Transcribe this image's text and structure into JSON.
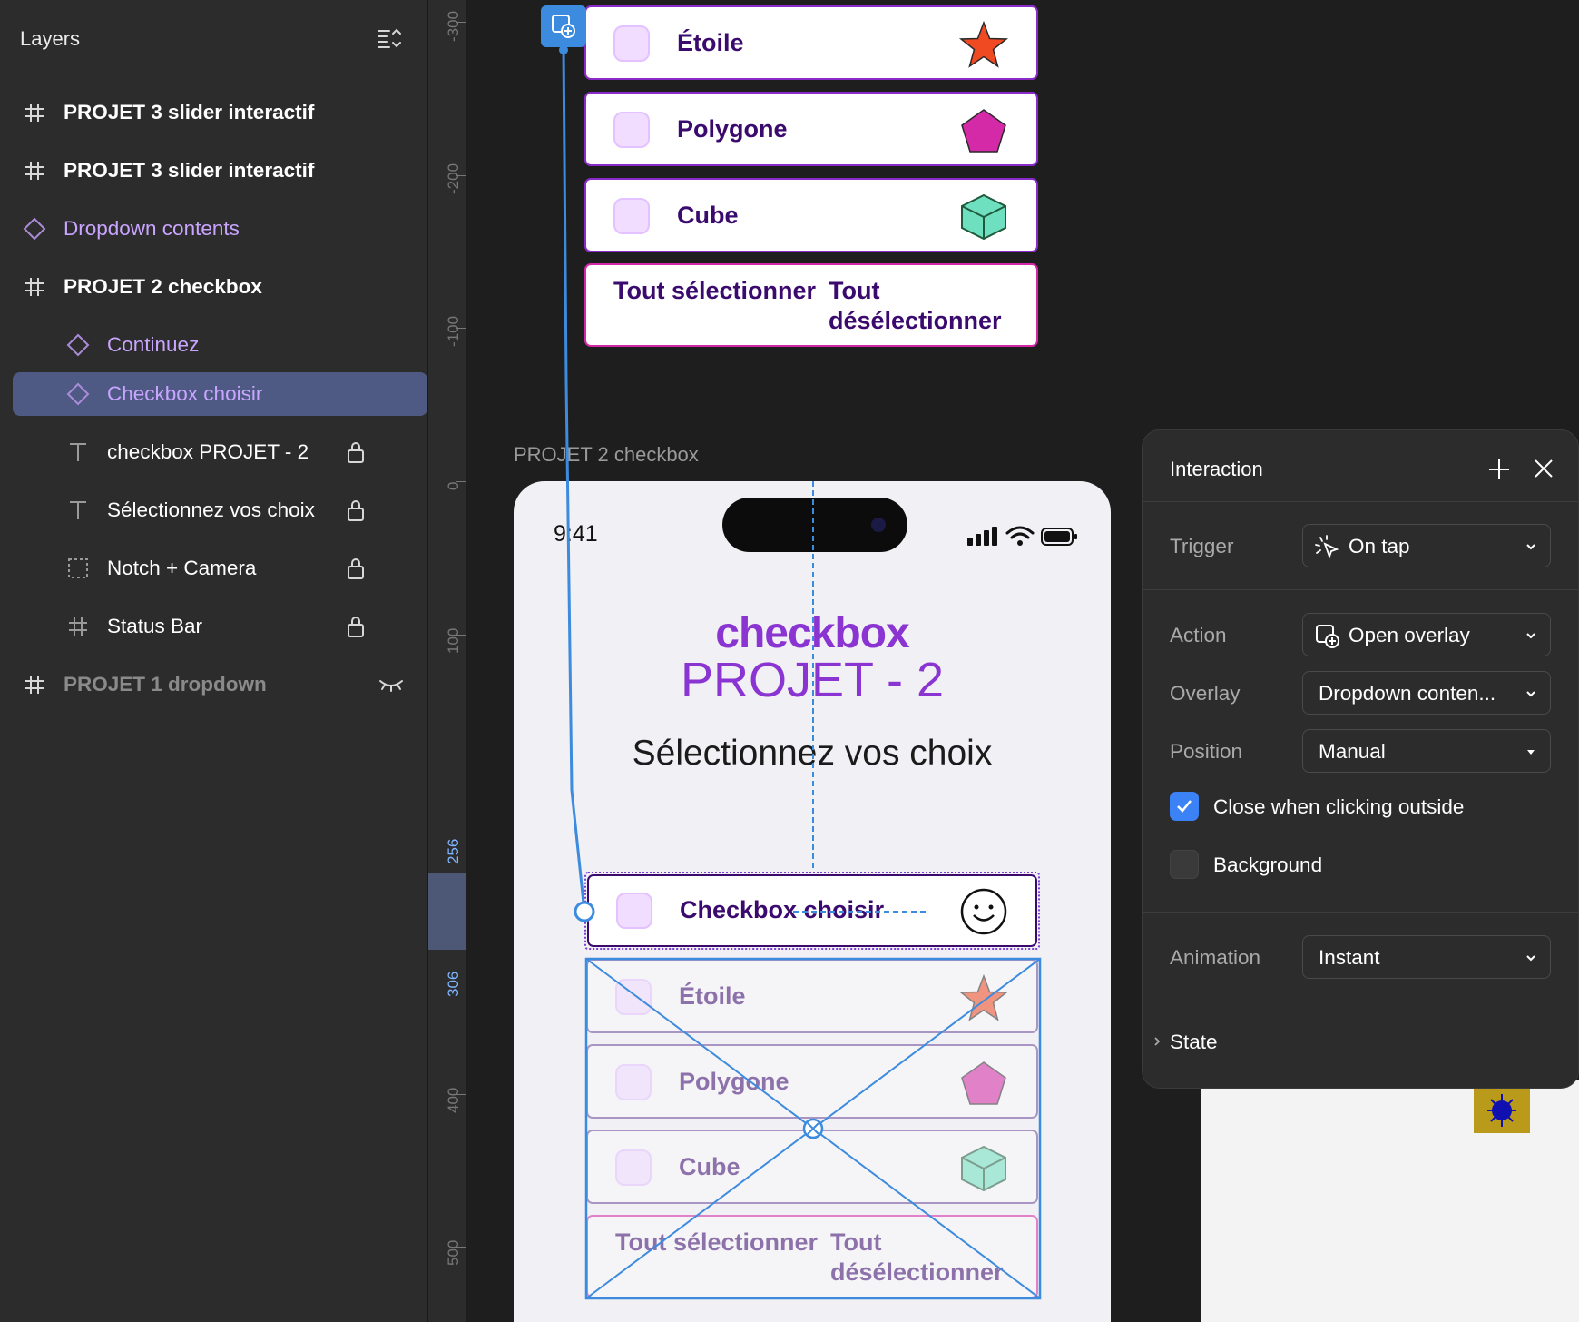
{
  "layers_panel": {
    "title": "Layers",
    "items": [
      {
        "label": "PROJET 3 slider interactif",
        "icon": "frame-icon"
      },
      {
        "label": "PROJET 3 slider interactif",
        "icon": "frame-icon"
      },
      {
        "label": "Dropdown contents",
        "icon": "component-icon"
      },
      {
        "label": "PROJET 2 checkbox",
        "icon": "frame-icon"
      },
      {
        "label": "Continuez",
        "icon": "component-icon"
      },
      {
        "label": "Checkbox choisir",
        "icon": "component-icon",
        "selected": true
      },
      {
        "label": "checkbox PROJET - 2",
        "icon": "text-icon",
        "locked": true
      },
      {
        "label": "Sélectionnez vos choix",
        "icon": "text-icon",
        "locked": true
      },
      {
        "label": "Notch + Camera",
        "icon": "group-icon",
        "locked": true
      },
      {
        "label": "Status Bar",
        "icon": "frame-icon",
        "locked": true
      },
      {
        "label": "PROJET 1 dropdown",
        "icon": "frame-icon",
        "hidden": true
      }
    ]
  },
  "ruler": {
    "labels": [
      "-300",
      "-200",
      "-100",
      "0",
      "100",
      "256",
      "306",
      "400",
      "500"
    ]
  },
  "overlay_preview": {
    "items": [
      "Étoile",
      "Polygone",
      "Cube"
    ],
    "select_all": "Tout sélectionner",
    "deselect_all": "Tout désélectionner"
  },
  "frame": {
    "label": "PROJET 2 checkbox",
    "time": "9:41",
    "title_bold": "checkbox",
    "title_light": "PROJET - 2",
    "subtitle": "Sélectionnez vos choix",
    "trigger_item": "Checkbox choisir",
    "items": [
      "Étoile",
      "Polygone",
      "Cube"
    ],
    "select_all": "Tout sélectionner",
    "deselect_all": "Tout désélectionner"
  },
  "interaction_panel": {
    "title": "Interaction",
    "trigger_label": "Trigger",
    "trigger_value": "On tap",
    "action_label": "Action",
    "action_value": "Open overlay",
    "overlay_label": "Overlay",
    "overlay_value": "Dropdown conten...",
    "position_label": "Position",
    "position_value": "Manual",
    "close_outside_label": "Close when clicking outside",
    "close_outside_checked": true,
    "background_label": "Background",
    "background_checked": false,
    "animation_label": "Animation",
    "animation_value": "Instant",
    "state_label": "State"
  },
  "colors": {
    "accent": "#8a35d2",
    "selection": "#4f5a84",
    "link": "#3d8bde",
    "checkbox_checked": "#3b82f6"
  }
}
